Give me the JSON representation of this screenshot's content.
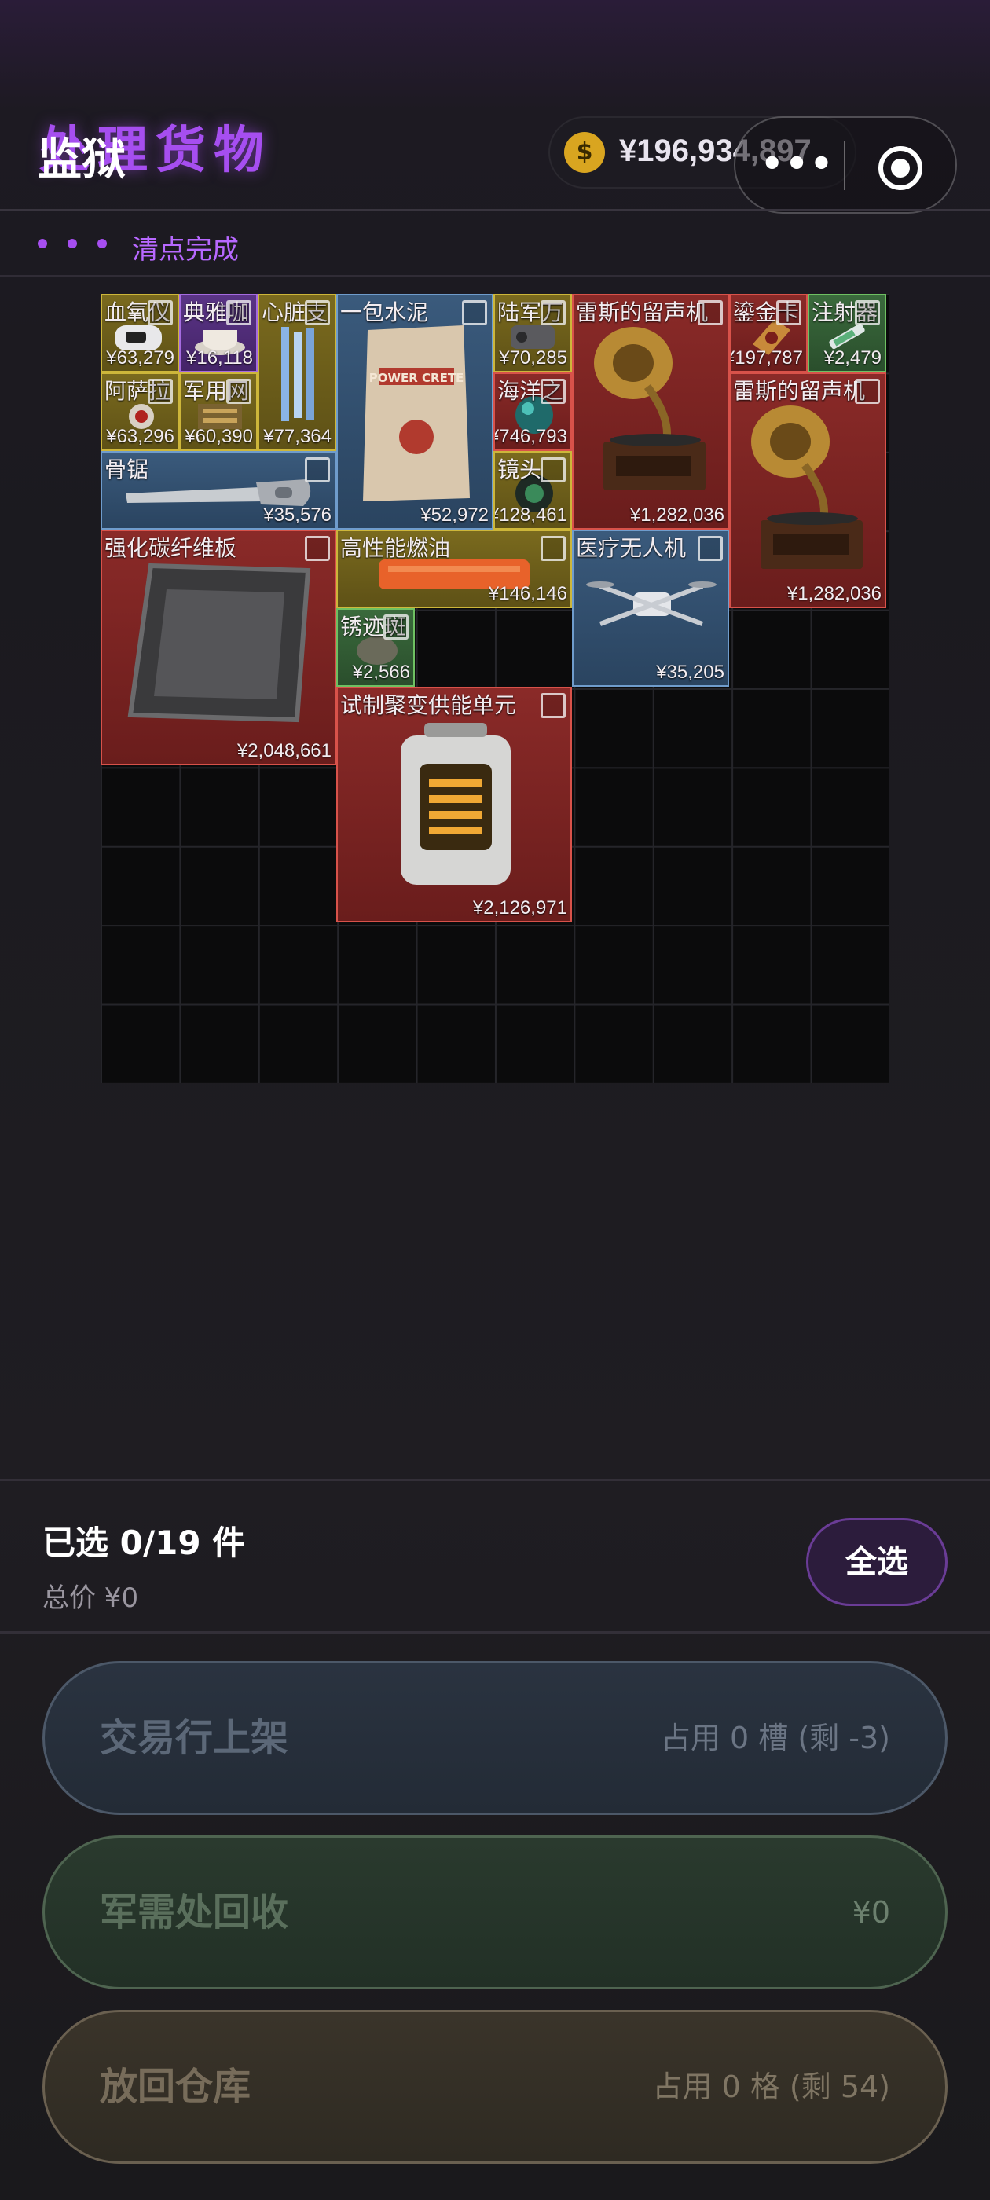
{
  "header": {
    "title_ghost": "处理货物",
    "title_main": "监狱",
    "coin_icon": "coin-icon",
    "coin_symbol": "$",
    "balance": "¥196,934,897"
  },
  "status": {
    "text": "清点完成"
  },
  "items": [
    {
      "name": "血氧仪",
      "price": "¥63,279",
      "rarity": "gold"
    },
    {
      "name": "典雅咖",
      "price": "¥16,118",
      "rarity": "purple"
    },
    {
      "name": "心脏支",
      "price": "¥77,364",
      "rarity": "gold"
    },
    {
      "name": "一包水泥",
      "price": "¥52,972",
      "rarity": "blue",
      "pic_text": "POWER CRETE"
    },
    {
      "name": "陆军万",
      "price": "¥70,285",
      "rarity": "gold"
    },
    {
      "name": "雷斯的留声机",
      "price": "¥1,282,036",
      "rarity": "red"
    },
    {
      "name": "鎏金卡",
      "price": "¥197,787",
      "rarity": "red"
    },
    {
      "name": "注射器",
      "price": "¥2,479",
      "rarity": "green"
    },
    {
      "name": "阿萨拉",
      "price": "¥63,296",
      "rarity": "gold"
    },
    {
      "name": "军用网",
      "price": "¥60,390",
      "rarity": "gold"
    },
    {
      "name": "海洋之",
      "price": "¥746,793",
      "rarity": "red"
    },
    {
      "name": "雷斯的留声机",
      "price": "¥1,282,036",
      "rarity": "red"
    },
    {
      "name": "骨锯",
      "price": "¥35,576",
      "rarity": "blue"
    },
    {
      "name": "镜头",
      "price": "¥128,461",
      "rarity": "gold"
    },
    {
      "name": "强化碳纤维板",
      "price": "¥2,048,661",
      "rarity": "red"
    },
    {
      "name": "高性能燃油",
      "price": "¥146,146",
      "rarity": "gold"
    },
    {
      "name": "医疗无人机",
      "price": "¥35,205",
      "rarity": "blue"
    },
    {
      "name": "锈迹斑",
      "price": "¥2,566",
      "rarity": "green"
    },
    {
      "name": "试制聚变供能单元",
      "price": "¥2,126,971",
      "rarity": "red"
    }
  ],
  "selection": {
    "count_label": "已选 0/19 件",
    "total_label": "总价  ¥0",
    "select_all": "全选"
  },
  "actions": {
    "market": {
      "label": "交易行上架",
      "info": "占用 0 槽 (剩 -3)"
    },
    "recycle": {
      "label": "军需处回收",
      "info": "¥0"
    },
    "store": {
      "label": "放回仓库",
      "info": "占用 0 格 (剩 54)"
    }
  },
  "colors": {
    "accent": "#a64ef0",
    "gold": "#cdb63a",
    "purple": "#a56be0",
    "blue": "#6f9ccc",
    "red": "#d8524a",
    "green": "#6ec062"
  }
}
